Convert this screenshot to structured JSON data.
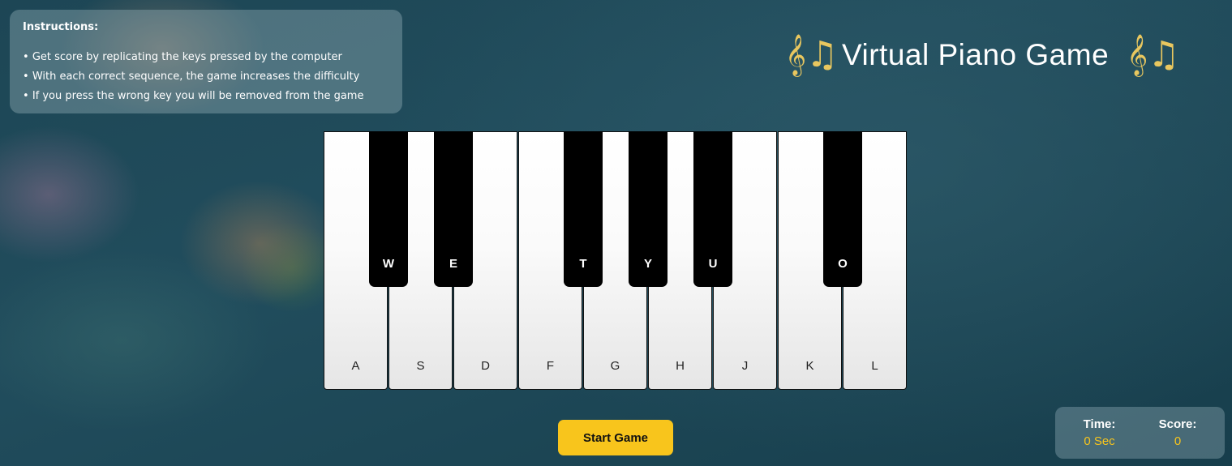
{
  "instructions": {
    "heading": "Instructions:",
    "items": [
      "Get score by replicating the keys pressed by the computer",
      "With each correct sequence, the game increases the difficulty",
      "If you press the wrong key you will be removed from the game"
    ]
  },
  "header": {
    "title": "Virtual Piano Game",
    "icon_left": "music-notes-icon",
    "icon_right": "music-notes-icon",
    "icon_glyph": "𝄞♫"
  },
  "piano": {
    "white_keys": [
      "A",
      "S",
      "D",
      "F",
      "G",
      "H",
      "J",
      "K",
      "L"
    ],
    "black_keys": [
      "W",
      "E",
      "T",
      "Y",
      "U",
      "O"
    ]
  },
  "controls": {
    "start_label": "Start Game"
  },
  "stats": {
    "time_label": "Time:",
    "time_value": "0 Sec",
    "score_label": "Score:",
    "score_value": "0"
  },
  "colors": {
    "accent": "#f8c51c",
    "background": "#1d4655",
    "note_gold": "#e9c75f"
  }
}
